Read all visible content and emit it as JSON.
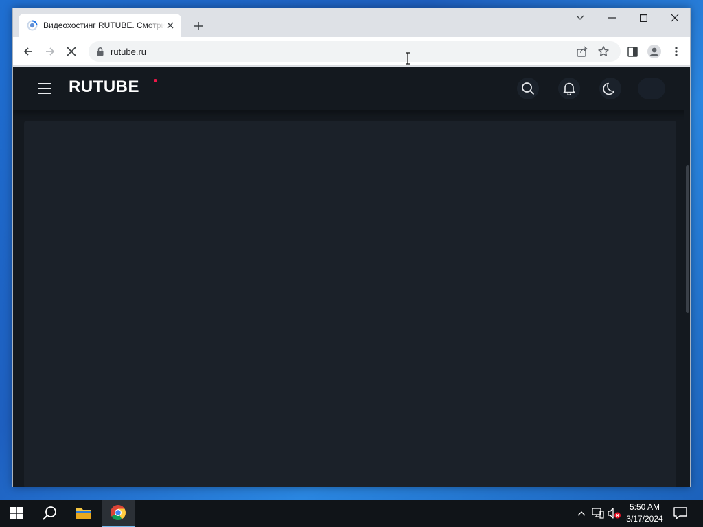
{
  "browser": {
    "tab": {
      "title": "Видеохостинг RUTUBE. Смотрите"
    },
    "address_bar": {
      "url": "rutube.ru"
    }
  },
  "page": {
    "logo_text": "RUTUBE",
    "brand_color": "#ED1848",
    "background_color": "#14191F",
    "icons": [
      "menu-icon",
      "search-icon",
      "bell-icon",
      "moon-icon",
      "avatar"
    ]
  },
  "taskbar": {
    "clock": {
      "time": "5:50 AM",
      "date": "3/17/2024"
    },
    "apps": [
      "start-icon",
      "search-icon",
      "file-explorer-icon",
      "chrome-icon"
    ]
  }
}
